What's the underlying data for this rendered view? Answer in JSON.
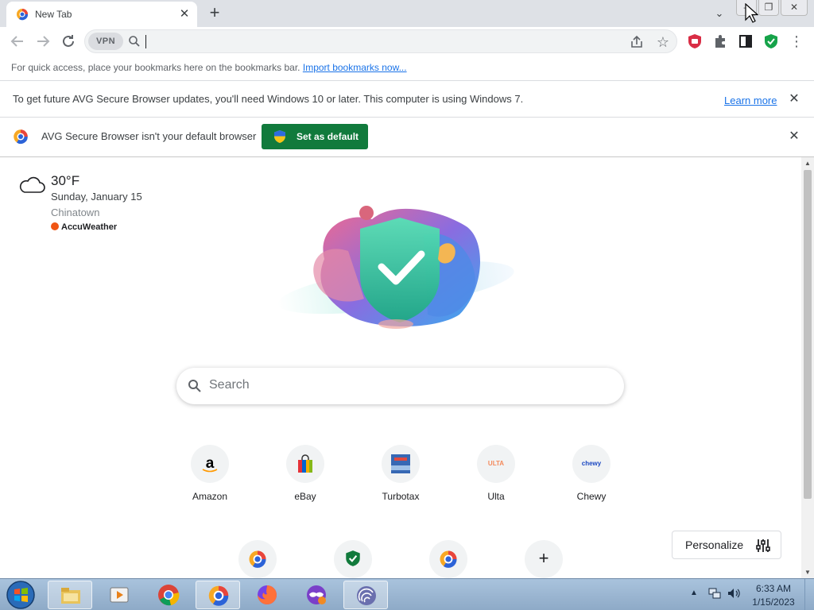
{
  "tab": {
    "title": "New Tab"
  },
  "window": {
    "tab_search": "⌄",
    "minimize": "–",
    "maximize": "❐",
    "close": "✕"
  },
  "toolbar": {
    "vpn_label": "VPN"
  },
  "bookmarks_bar": {
    "text": "For quick access, place your bookmarks here on the bookmarks bar.",
    "link": "Import bookmarks now..."
  },
  "infobar_update": {
    "text": "To get future AVG Secure Browser updates, you'll need Windows 10 or later. This computer is using Windows 7.",
    "learn_more": "Learn more"
  },
  "infobar_default": {
    "text": "AVG Secure Browser isn't your default browser",
    "button": "Set as default"
  },
  "weather": {
    "temperature": "30°F",
    "date": "Sunday, January 15",
    "location": "Chinatown",
    "provider": "AccuWeather"
  },
  "search": {
    "placeholder": "Search"
  },
  "shortcuts": [
    {
      "label": "Amazon",
      "glyph": "a"
    },
    {
      "label": "eBay",
      "glyph": "🛍"
    },
    {
      "label": "Turbotax",
      "glyph": "TT"
    },
    {
      "label": "Ulta",
      "glyph": "ULTA"
    },
    {
      "label": "Chewy",
      "glyph": "chewy"
    }
  ],
  "shortcuts_row2": [
    {
      "icon": "avg-browser-icon"
    },
    {
      "icon": "shield-icon"
    },
    {
      "icon": "avg-browser-icon"
    },
    {
      "icon": "add-shortcut-icon",
      "glyph": "+"
    }
  ],
  "personalize": {
    "label": "Personalize"
  },
  "taskbar": {
    "items": [
      "start-button",
      "file-explorer",
      "media-player",
      "google-chrome",
      "avg-secure-browser",
      "firefox",
      "tor-incognito",
      "app-swirl"
    ],
    "clock_time": "6:33 AM",
    "clock_date": "1/15/2023"
  },
  "colors": {
    "accent_green": "#117a3c",
    "link_blue": "#1a73e8",
    "tab_strip": "#dee1e6",
    "taskbar": "#8eaac7"
  }
}
